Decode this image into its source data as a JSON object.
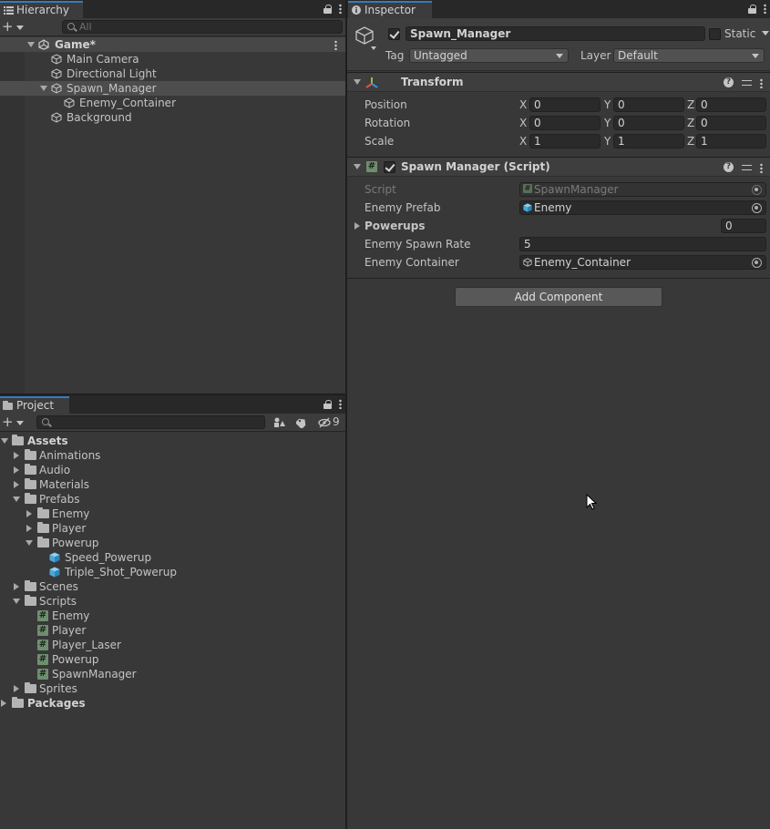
{
  "hierarchy": {
    "tab_label": "Hierarchy",
    "search_placeholder": "All",
    "scene_name": "Game*",
    "items": [
      {
        "label": "Main Camera"
      },
      {
        "label": "Directional Light"
      },
      {
        "label": "Spawn_Manager"
      },
      {
        "label": "Enemy_Container"
      },
      {
        "label": "Background"
      }
    ]
  },
  "project": {
    "tab_label": "Project",
    "hidden_count": "9",
    "tree": [
      {
        "label": "Assets"
      },
      {
        "label": "Animations"
      },
      {
        "label": "Audio"
      },
      {
        "label": "Materials"
      },
      {
        "label": "Prefabs"
      },
      {
        "label": "Enemy"
      },
      {
        "label": "Player"
      },
      {
        "label": "Powerup"
      },
      {
        "label": "Speed_Powerup"
      },
      {
        "label": "Triple_Shot_Powerup"
      },
      {
        "label": "Scenes"
      },
      {
        "label": "Scripts"
      },
      {
        "label": "Enemy"
      },
      {
        "label": "Player"
      },
      {
        "label": "Player_Laser"
      },
      {
        "label": "Powerup"
      },
      {
        "label": "SpawnManager"
      },
      {
        "label": "Sprites"
      },
      {
        "label": "Packages"
      }
    ]
  },
  "inspector": {
    "tab_label": "Inspector",
    "object_name": "Spawn_Manager",
    "static_label": "Static",
    "tag_label": "Tag",
    "tag_value": "Untagged",
    "layer_label": "Layer",
    "layer_value": "Default",
    "transform": {
      "title": "Transform",
      "position_label": "Position",
      "rotation_label": "Rotation",
      "scale_label": "Scale",
      "axis_x": "X",
      "axis_y": "Y",
      "axis_z": "Z",
      "position": [
        "0",
        "0",
        "0"
      ],
      "rotation": [
        "0",
        "0",
        "0"
      ],
      "scale": [
        "1",
        "1",
        "1"
      ]
    },
    "spawn_manager": {
      "title": "Spawn Manager (Script)",
      "script_label": "Script",
      "script_value": "SpawnManager",
      "enemy_prefab_label": "Enemy Prefab",
      "enemy_prefab_value": "Enemy",
      "powerups_label": "Powerups",
      "powerups_value": "0",
      "spawn_rate_label": "Enemy Spawn Rate",
      "spawn_rate_value": "5",
      "container_label": "Enemy Container",
      "container_value": "Enemy_Container"
    },
    "add_component_label": "Add Component"
  },
  "colors": {
    "panel_bg": "#383838",
    "selection": "#4d4d4d",
    "tab_accent": "#3a79bb",
    "prefab_blue": "#4aa8d8"
  }
}
